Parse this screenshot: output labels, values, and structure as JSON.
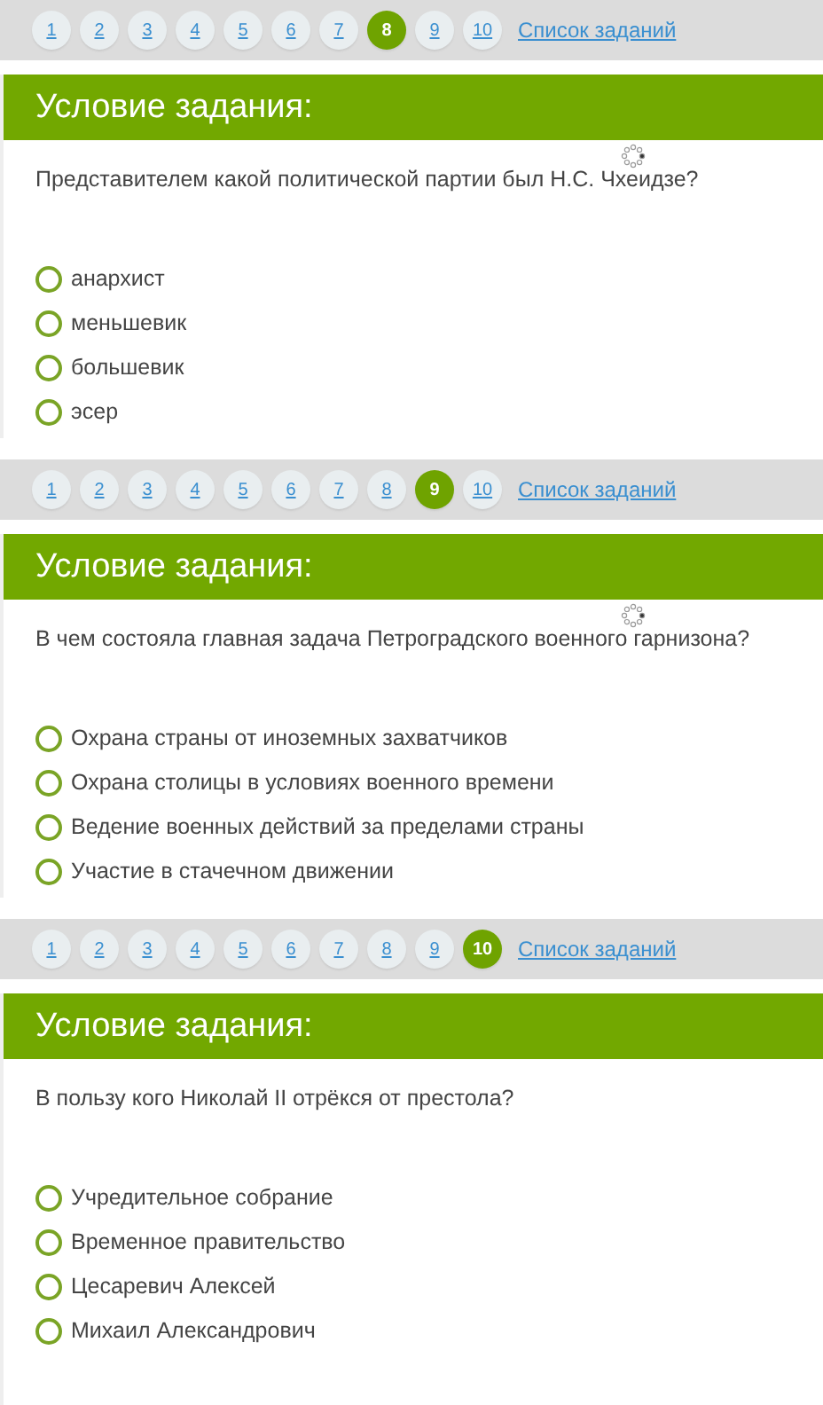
{
  "sections": [
    {
      "pages": [
        {
          "label": "1",
          "selected": false
        },
        {
          "label": "2",
          "selected": false
        },
        {
          "label": "3",
          "selected": false
        },
        {
          "label": "4",
          "selected": false
        },
        {
          "label": "5",
          "selected": false
        },
        {
          "label": "6",
          "selected": false
        },
        {
          "label": "7",
          "selected": false
        },
        {
          "label": "8",
          "selected": true
        },
        {
          "label": "9",
          "selected": false
        },
        {
          "label": "10",
          "selected": false
        }
      ],
      "list_link": "Список заданий",
      "heading": "Условие задания:",
      "loading": true,
      "question": "Представителем какой политической партии был Н.С. Чхеидзе?",
      "options": [
        {
          "label": "анархист",
          "selected": false
        },
        {
          "label": "меньшевик",
          "selected": false
        },
        {
          "label": "большевик",
          "selected": false
        },
        {
          "label": "эсер",
          "selected": false
        }
      ]
    },
    {
      "pages": [
        {
          "label": "1",
          "selected": false
        },
        {
          "label": "2",
          "selected": false
        },
        {
          "label": "3",
          "selected": false
        },
        {
          "label": "4",
          "selected": false
        },
        {
          "label": "5",
          "selected": false
        },
        {
          "label": "6",
          "selected": false
        },
        {
          "label": "7",
          "selected": false
        },
        {
          "label": "8",
          "selected": false
        },
        {
          "label": "9",
          "selected": true
        },
        {
          "label": "10",
          "selected": false
        }
      ],
      "list_link": "Список заданий",
      "heading": "Условие задания:",
      "loading": true,
      "question": "В чем состояла главная задача Петроградского военного гарнизона?",
      "options": [
        {
          "label": "Охрана страны от иноземных захватчиков",
          "selected": false
        },
        {
          "label": "Охрана столицы в условиях военного времени",
          "selected": false
        },
        {
          "label": "Ведение военных действий за пределами страны",
          "selected": false
        },
        {
          "label": "Участие в стачечном движении",
          "selected": false
        }
      ]
    },
    {
      "pages": [
        {
          "label": "1",
          "selected": false
        },
        {
          "label": "2",
          "selected": false
        },
        {
          "label": "3",
          "selected": false
        },
        {
          "label": "4",
          "selected": false
        },
        {
          "label": "5",
          "selected": false
        },
        {
          "label": "6",
          "selected": false
        },
        {
          "label": "7",
          "selected": false
        },
        {
          "label": "8",
          "selected": false
        },
        {
          "label": "9",
          "selected": false
        },
        {
          "label": "10",
          "selected": true
        }
      ],
      "list_link": "Список заданий",
      "heading": "Условие задания:",
      "loading": false,
      "question": "В пользу кого Николай II отрёкся от престола?",
      "options": [
        {
          "label": "Учредительное собрание",
          "selected": false
        },
        {
          "label": "Временное правительство",
          "selected": false
        },
        {
          "label": "Цесаревич Алексей",
          "selected": false
        },
        {
          "label": "Михаил Александрович",
          "selected": false
        }
      ]
    }
  ]
}
